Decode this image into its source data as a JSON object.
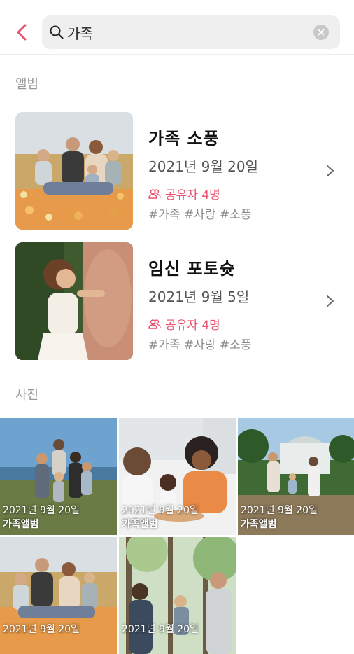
{
  "search": {
    "value": "가족",
    "back_icon": "chevron-left-icon",
    "search_icon": "search-icon",
    "clear_icon": "clear-icon"
  },
  "colors": {
    "accent": "#e8526e",
    "section_title": "#9a9a9a",
    "search_bg": "#efefef"
  },
  "albums_section": {
    "title": "앨범",
    "items": [
      {
        "name": "가족 소풍",
        "date": "2021년 9월 20일",
        "share": "공유자 4명",
        "tags": "#가족 #사랑 #소풍"
      },
      {
        "name": "임신 포토슛",
        "date": "2021년 9월 5일",
        "share": "공유자 4명",
        "tags": "#가족 #사랑 #소풍"
      }
    ]
  },
  "photos_section": {
    "title": "사진",
    "items": [
      {
        "date": "2021년 9월 20일",
        "album": "가족앨범"
      },
      {
        "date": "2021년 9월 20일",
        "album": "가족앨범"
      },
      {
        "date": "2021년 9월 20일",
        "album": "가족앨범"
      },
      {
        "date": "2021년 9월 20일",
        "album": ""
      },
      {
        "date": "2021년 9월 20일",
        "album": ""
      }
    ]
  }
}
